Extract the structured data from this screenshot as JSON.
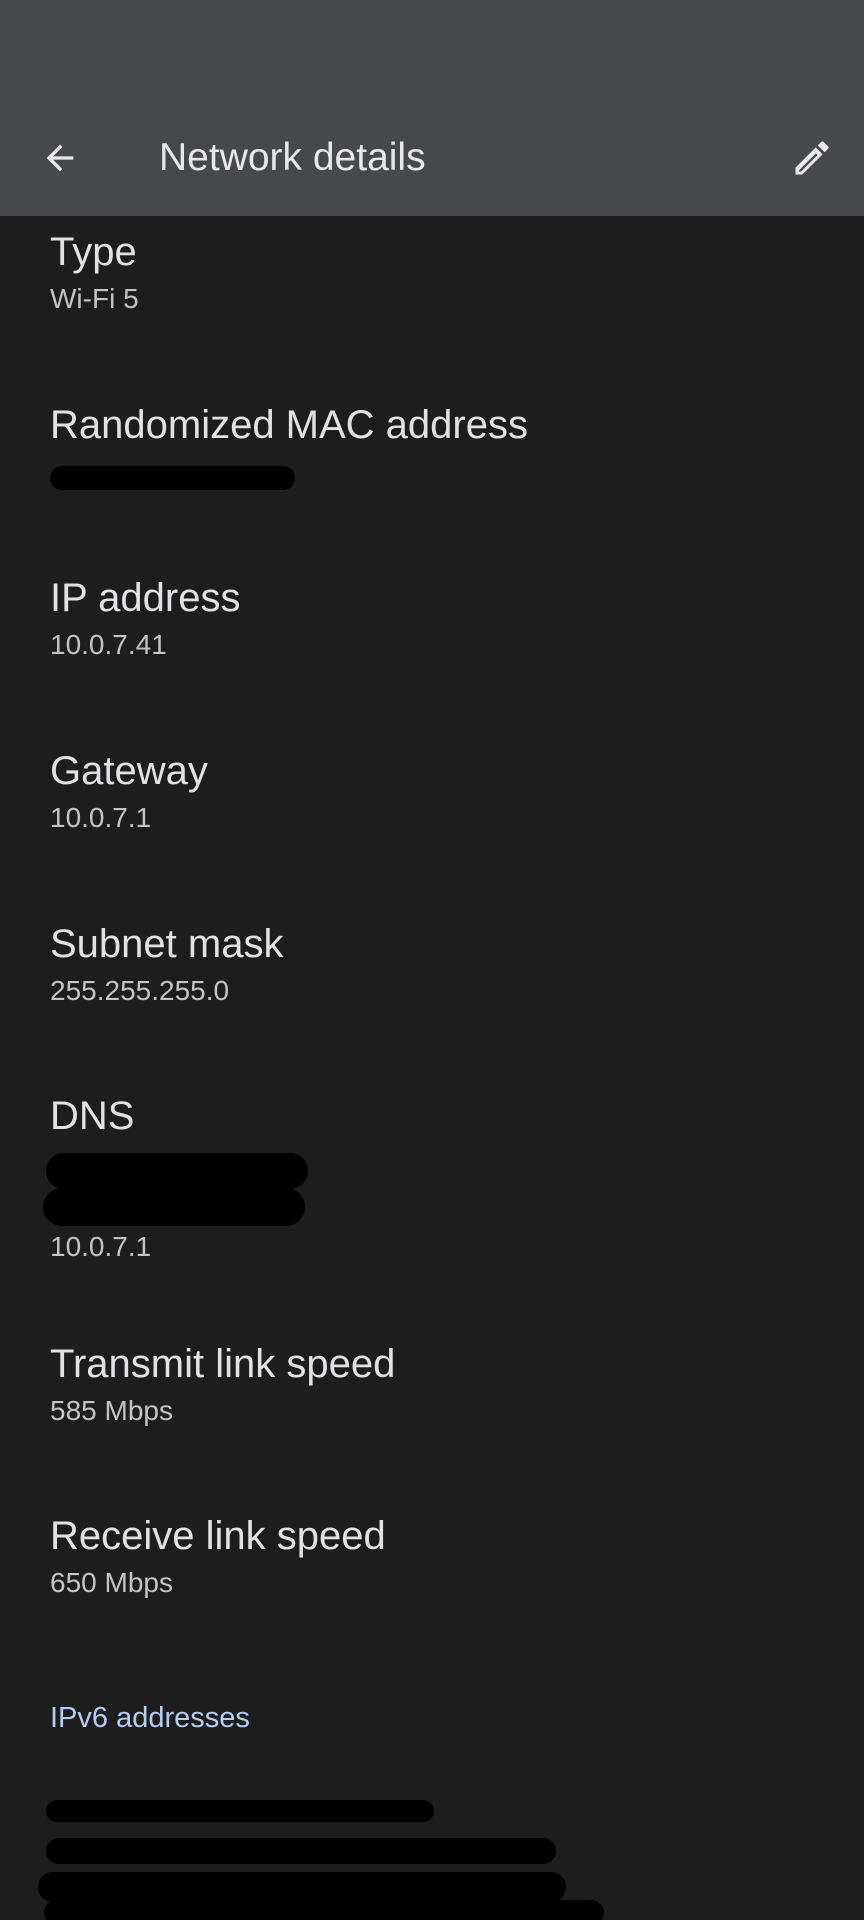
{
  "header": {
    "title": "Network details",
    "back_icon": "arrow-back-icon",
    "edit_icon": "edit-pencil-icon"
  },
  "details": {
    "type": {
      "title": "Type",
      "value": "Wi-Fi 5"
    },
    "mac": {
      "title": "Randomized MAC address"
    },
    "ip": {
      "title": "IP address",
      "value": "10.0.7.41"
    },
    "gateway": {
      "title": "Gateway",
      "value": "10.0.7.1"
    },
    "subnet": {
      "title": "Subnet mask",
      "value": "255.255.255.0"
    },
    "dns": {
      "title": "DNS",
      "value": "10.0.7.1"
    },
    "tx": {
      "title": "Transmit link speed",
      "value": "585 Mbps"
    },
    "rx": {
      "title": "Receive link speed",
      "value": "650 Mbps"
    }
  },
  "ipv6": {
    "header": "IPv6 addresses"
  },
  "colors": {
    "app_bar": "#47484c",
    "background": "#1d1d1e",
    "accent": "#b6cdf3"
  }
}
